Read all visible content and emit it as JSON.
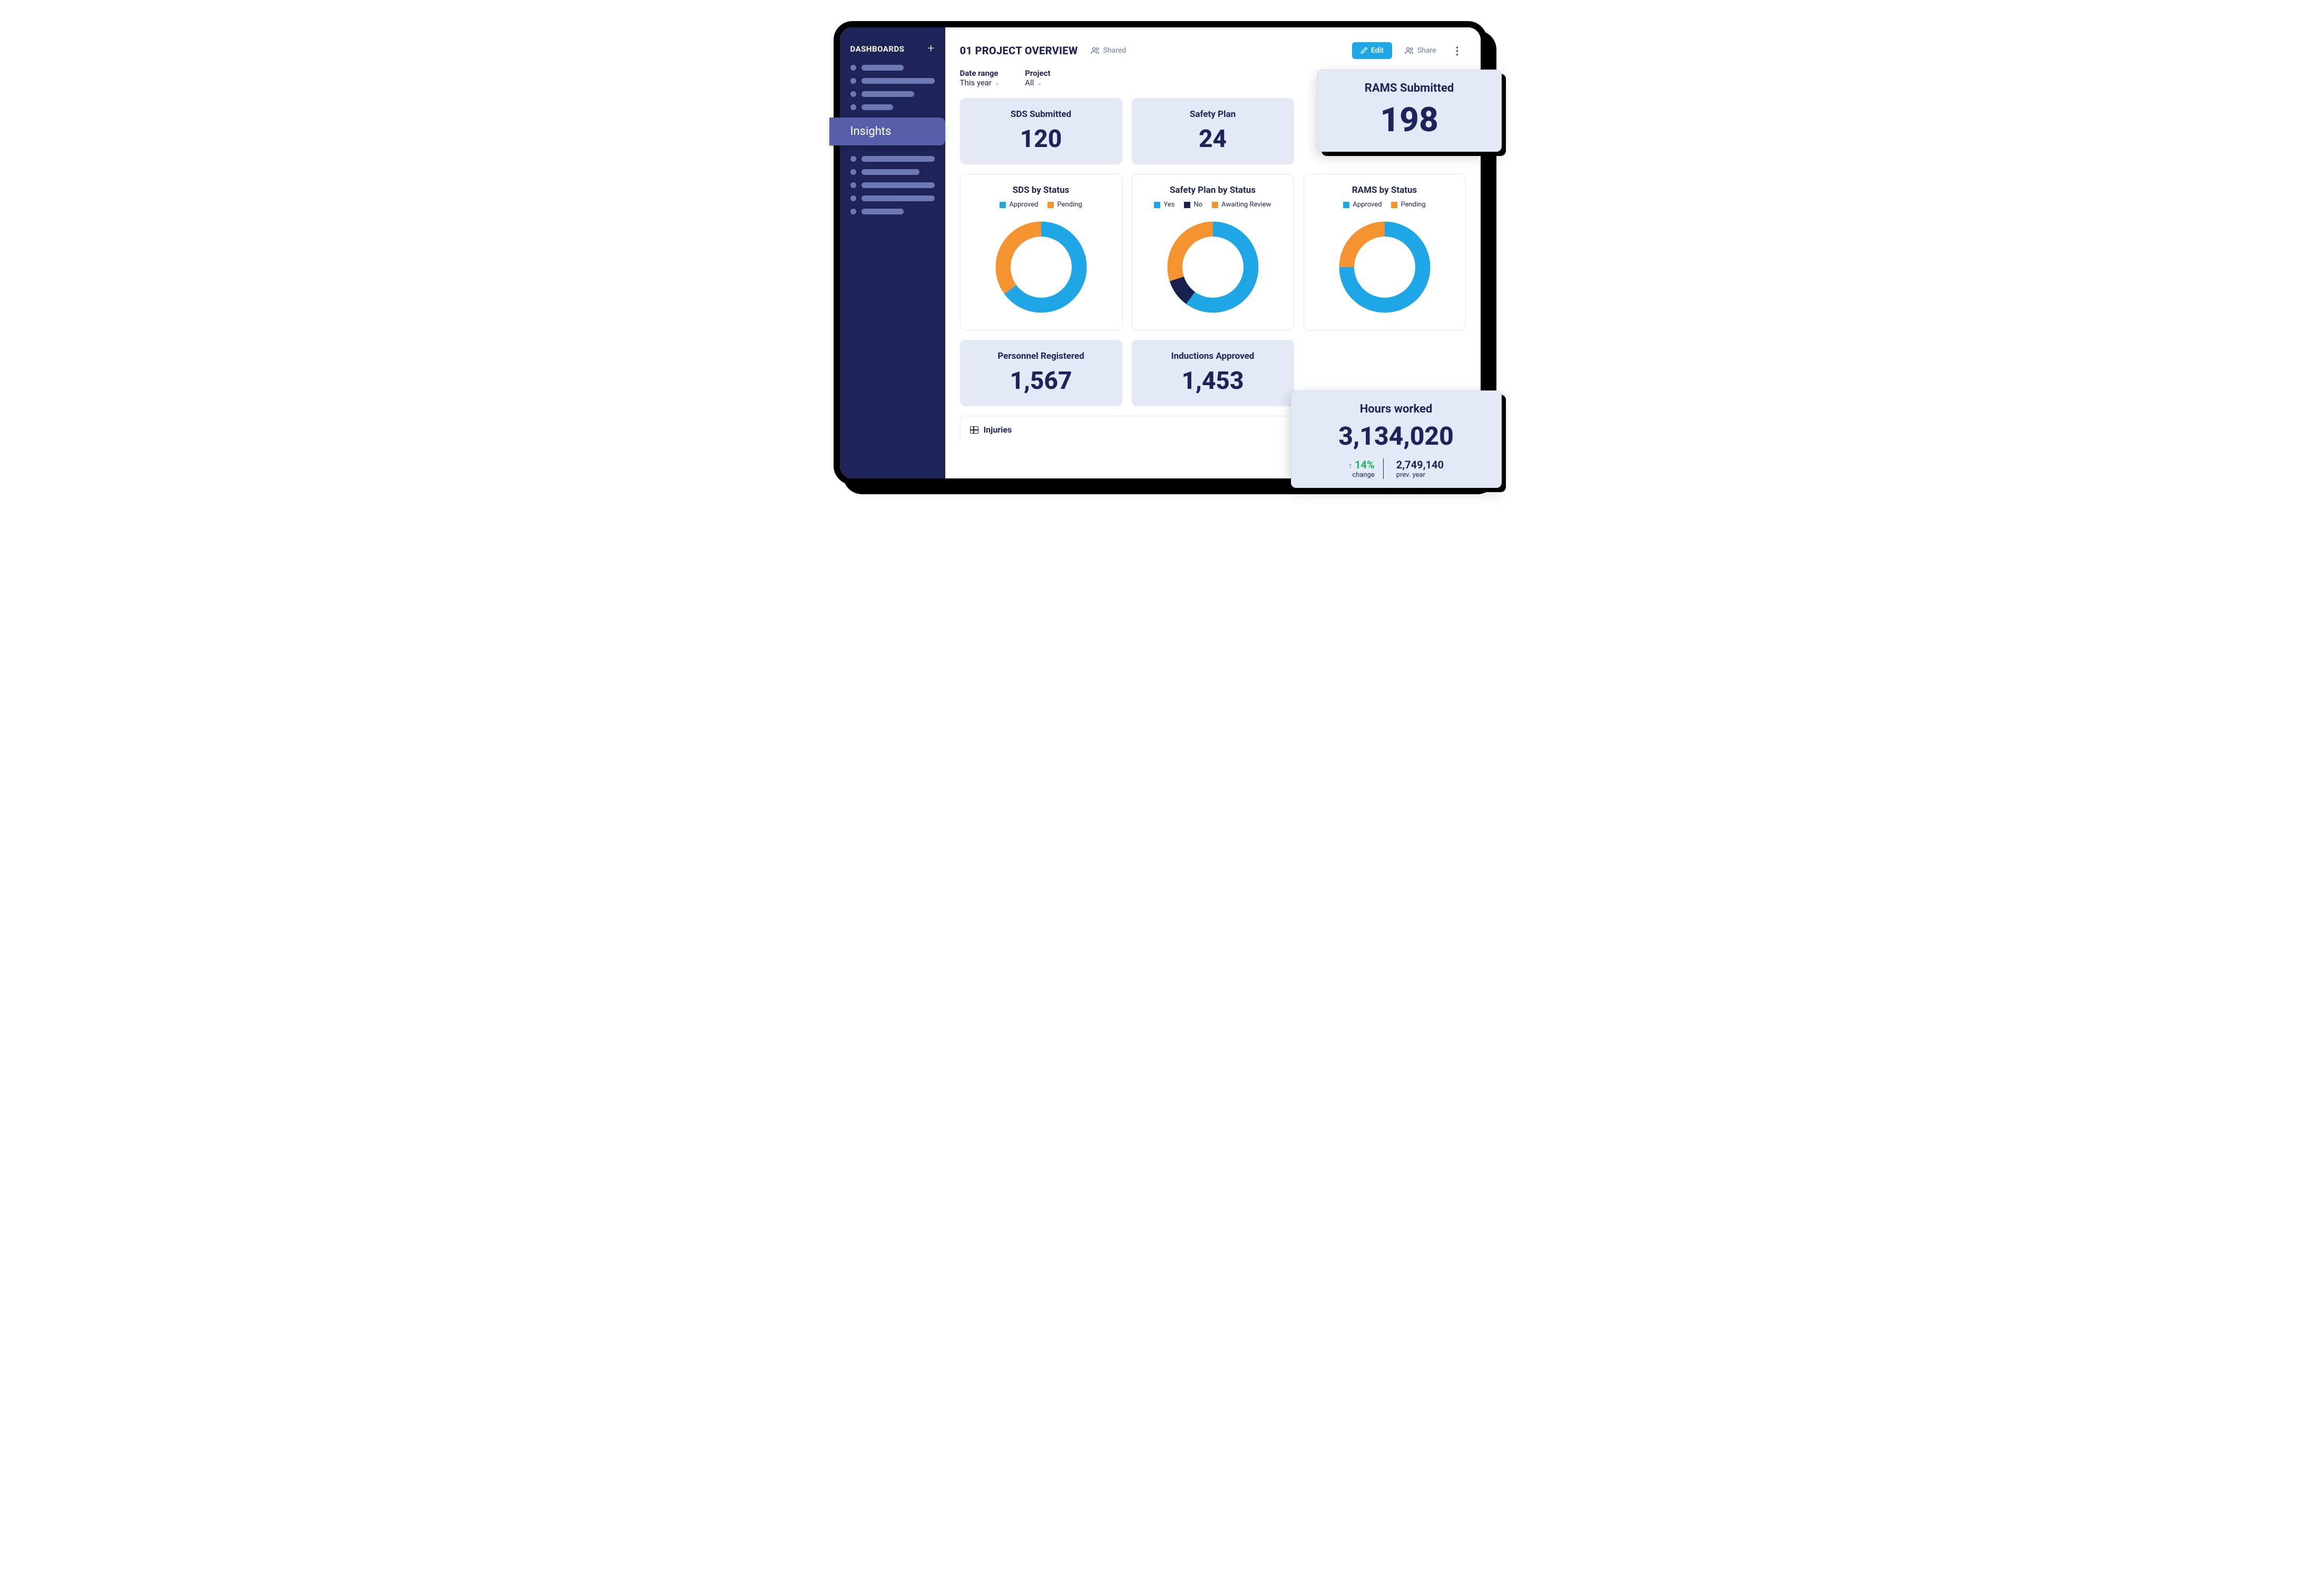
{
  "sidebar": {
    "title": "DASHBOARDS",
    "active_label": "Insights"
  },
  "header": {
    "title": "01 PROJECT OVERVIEW",
    "shared_badge": "Shared",
    "edit_label": "Edit",
    "share_label": "Share"
  },
  "filters": {
    "date_range_label": "Date range",
    "date_range_value": "This year",
    "project_label": "Project",
    "project_value": "All"
  },
  "stats": {
    "sds": {
      "title": "SDS Submitted",
      "value": "120"
    },
    "safety_plan": {
      "title": "Safety Plan",
      "value": "24"
    },
    "rams": {
      "title": "RAMS Submitted",
      "value": "198"
    },
    "personnel": {
      "title": "Personnel Registered",
      "value": "1,567"
    },
    "inductions": {
      "title": "Inductions Approved",
      "value": "1,453"
    },
    "hours": {
      "title": "Hours worked",
      "value": "3,134,020",
      "change_pct": "14%",
      "change_label": "change",
      "prev_value": "2,749,140",
      "prev_label": "prev. year"
    }
  },
  "charts": {
    "sds": {
      "title": "SDS by Status",
      "legend": [
        {
          "label": "Approved",
          "color": "#1ea6e6"
        },
        {
          "label": "Pending",
          "color": "#f59331"
        }
      ]
    },
    "safety": {
      "title": "Safety Plan by Status",
      "legend": [
        {
          "label": "Yes",
          "color": "#1ea6e6"
        },
        {
          "label": "No",
          "color": "#17204f"
        },
        {
          "label": "Awaiting Review",
          "color": "#f59331"
        }
      ]
    },
    "rams": {
      "title": "RAMS by Status",
      "legend": [
        {
          "label": "Approved",
          "color": "#1ea6e6"
        },
        {
          "label": "Pending",
          "color": "#f59331"
        }
      ]
    }
  },
  "injuries": {
    "title": "Injuries"
  },
  "colors": {
    "blue": "#1ea6e6",
    "orange": "#f59331",
    "navy": "#17204f"
  },
  "chart_data": [
    {
      "type": "pie",
      "title": "SDS by Status",
      "series": [
        {
          "name": "Approved",
          "value": 65
        },
        {
          "name": "Pending",
          "value": 35
        }
      ]
    },
    {
      "type": "pie",
      "title": "Safety Plan by Status",
      "series": [
        {
          "name": "Yes",
          "value": 60
        },
        {
          "name": "No",
          "value": 10
        },
        {
          "name": "Awaiting Review",
          "value": 30
        }
      ]
    },
    {
      "type": "pie",
      "title": "RAMS by Status",
      "series": [
        {
          "name": "Approved",
          "value": 75
        },
        {
          "name": "Pending",
          "value": 25
        }
      ]
    }
  ]
}
